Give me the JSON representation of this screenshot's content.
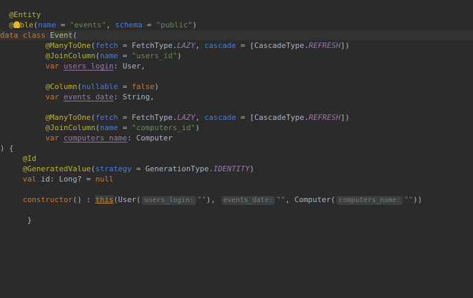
{
  "code": {
    "l1_ann": "@Entity",
    "l2_at": "@",
    "l2_rest": "ble",
    "l2_paren": "(",
    "l2_name_param": "name",
    "l2_eq1": " = ",
    "l2_name_val": "\"events\"",
    "l2_comma": ", ",
    "l2_schema_param": "schema",
    "l2_eq2": " = ",
    "l2_schema_val": "\"public\"",
    "l2_close": ")",
    "l3_kw": "data class ",
    "l3_class": "Event",
    "l3_paren": "(",
    "l4_ann": "@ManyToOne",
    "l4_p1": "(",
    "l4_fetch": "fetch",
    "l4_eq1": " = FetchType.",
    "l4_lazy": "LAZY",
    "l4_comma": ", ",
    "l4_cascade": "cascade",
    "l4_eq2": " = [CascadeType.",
    "l4_refresh": "REFRESH",
    "l4_close": "])",
    "l5_ann": "@JoinColumn",
    "l5_p1": "(",
    "l5_name": "name",
    "l5_eq": " = ",
    "l5_val": "\"users_id\"",
    "l5_close": ")",
    "l6_kw": "var ",
    "l6_prop": "users_login",
    "l6_rest": ": User,",
    "l8_ann": "@Column",
    "l8_p1": "(",
    "l8_param": "nullable",
    "l8_eq": " = ",
    "l8_val": "false",
    "l8_close": ")",
    "l9_kw": "var ",
    "l9_prop": "events_date",
    "l9_rest": ": String,",
    "l11_ann": "@ManyToOne",
    "l11_p1": "(",
    "l11_fetch": "fetch",
    "l11_eq1": " = FetchType.",
    "l11_lazy": "LAZY",
    "l11_comma": ", ",
    "l11_cascade": "cascade",
    "l11_eq2": " = [CascadeType.",
    "l11_refresh": "REFRESH",
    "l11_close": "])",
    "l12_ann": "@JoinColumn",
    "l12_p1": "(",
    "l12_name": "name",
    "l12_eq": " = ",
    "l12_val": "\"computers_id\"",
    "l12_close": ")",
    "l13_kw": "var ",
    "l13_prop": "computers_name",
    "l13_rest": ": Computer",
    "l14_text": ") {",
    "l15_ann": "@Id",
    "l16_ann": "@GeneratedValue",
    "l16_p1": "(",
    "l16_param": "strategy",
    "l16_eq": " = GenerationType.",
    "l16_const": "IDENTITY",
    "l16_close": ")",
    "l17_kw": "val ",
    "l17_rest": "id: Long? = ",
    "l17_null": "null",
    "l19_kw": "constructor",
    "l19_a": "() : ",
    "l19_this": "this",
    "l19_b": "(User(",
    "l19_hint1": "users_login:",
    "l19_s1": "\"\"",
    "l19_c": "),",
    "l19_hint2": "events_date:",
    "l19_s2": "\"\"",
    "l19_d": ", Computer(",
    "l19_hint3": "computers_name:",
    "l19_s3": "\"\"",
    "l19_e": "))",
    "l21_text": "}"
  }
}
